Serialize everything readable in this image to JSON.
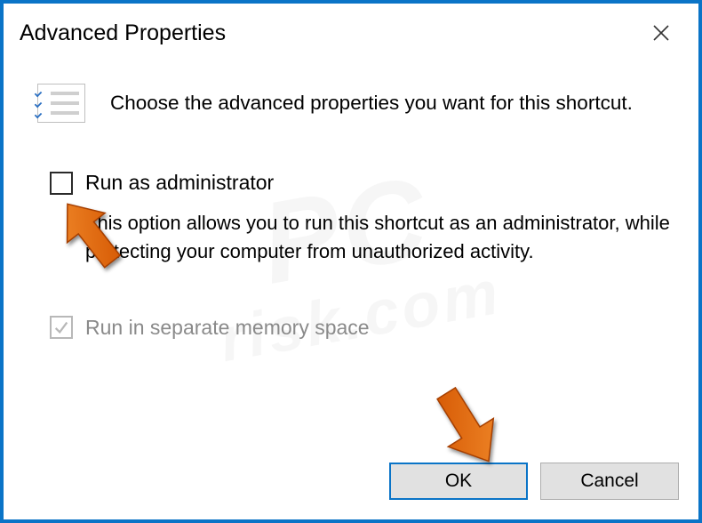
{
  "titlebar": {
    "title": "Advanced Properties",
    "close_label": "Close"
  },
  "intro": "Choose the advanced properties you want for this shortcut.",
  "options": {
    "run_as_admin": {
      "label": "Run as administrator",
      "desc": "This option allows you to run this shortcut as an administrator, while protecting your computer from unauthorized activity.",
      "checked": false
    },
    "separate_memory": {
      "label": "Run in separate memory space",
      "checked": true,
      "disabled": true
    }
  },
  "buttons": {
    "ok": "OK",
    "cancel": "Cancel"
  },
  "watermark": {
    "line1": "PC",
    "line2": "risk.com"
  }
}
